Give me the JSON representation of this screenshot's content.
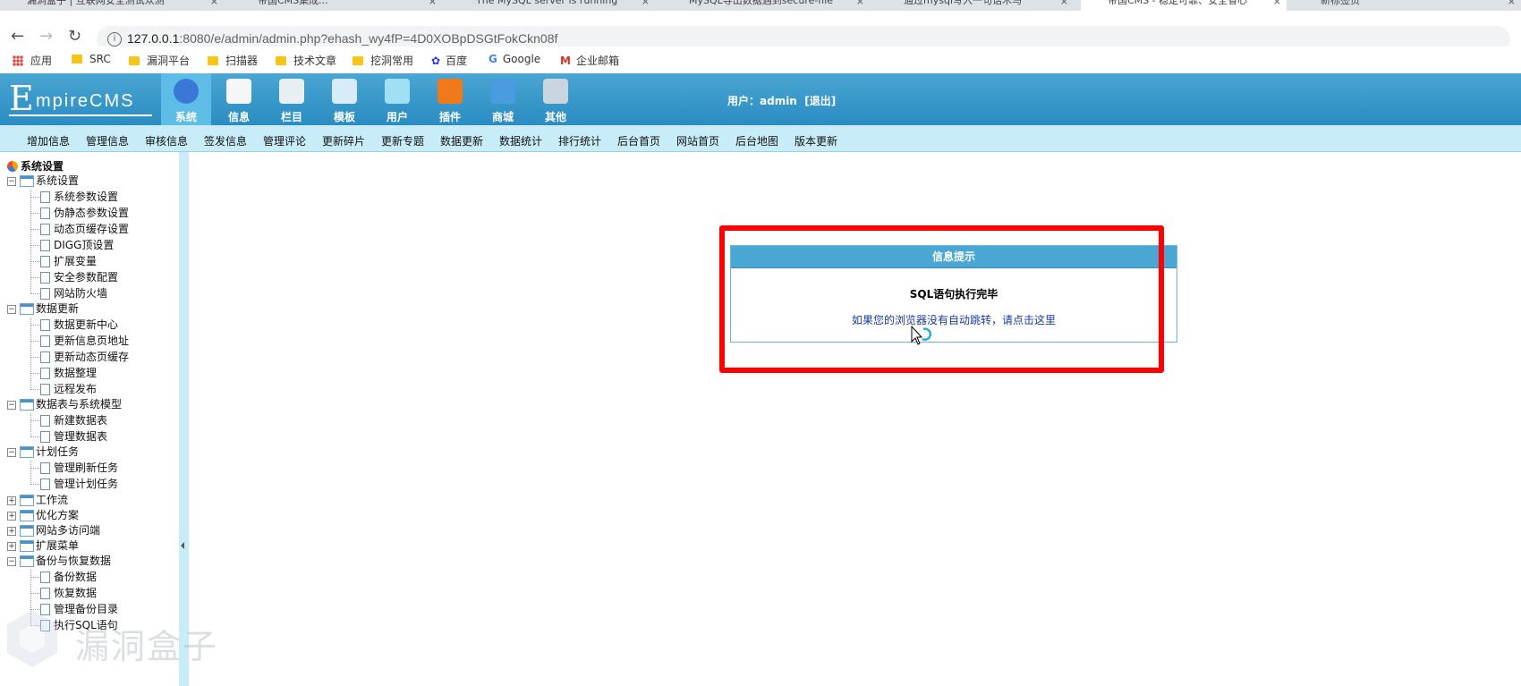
{
  "browser": {
    "tabs": [
      {
        "label": "漏洞盒子 | 互联网安全测试众测"
      },
      {
        "label": "帝国CMS集成..."
      },
      {
        "label": "The MySQL server is running"
      },
      {
        "label": "MySQL导出数据遇到secure-file"
      },
      {
        "label": "通过mysql写入一句话木马"
      },
      {
        "label": "帝国CMS - 稳定可靠、安全省心"
      },
      {
        "label": "新标签页"
      }
    ],
    "url_host": "127.0.0.1",
    "url_rest": ":8080/e/admin/admin.php?ehash_wy4fP=4D0XOBpDSGtFokCkn08f",
    "bookmarks": [
      "应用",
      "SRC",
      "漏洞平台",
      "扫描器",
      "技术文章",
      "挖洞常用",
      "百度",
      "Google",
      "企业邮箱"
    ]
  },
  "header": {
    "logo_big": "E",
    "logo_rest": "mpireCMS",
    "modules": [
      {
        "label": "系统",
        "icon": "globe-icon",
        "color": "#3a78d8"
      },
      {
        "label": "信息",
        "icon": "document-edit-icon",
        "color": "#f6f6f6"
      },
      {
        "label": "栏目",
        "icon": "folder-icon",
        "color": "#e9eef2"
      },
      {
        "label": "模板",
        "icon": "window-template-icon",
        "color": "#d8ecf8"
      },
      {
        "label": "用户",
        "icon": "user-icon",
        "color": "#9fe0f5"
      },
      {
        "label": "插件",
        "icon": "tools-icon",
        "color": "#f07a1a"
      },
      {
        "label": "商城",
        "icon": "credit-card-icon",
        "color": "#4a9ce0"
      },
      {
        "label": "其他",
        "icon": "gear-icon",
        "color": "#c9d6df"
      }
    ],
    "user_label": "用户：admin",
    "logout_label": "[退出]"
  },
  "subnav": [
    "增加信息",
    "管理信息",
    "审核信息",
    "签发信息",
    "管理评论",
    "更新碎片",
    "更新专题",
    "数据更新",
    "数据统计",
    "排行统计",
    "后台首页",
    "网站首页",
    "后台地图",
    "版本更新"
  ],
  "sidebar": {
    "root": "系统设置",
    "groups": [
      {
        "label": "系统设置",
        "open": true,
        "items": [
          "系统参数设置",
          "伪静态参数设置",
          "动态页缓存设置",
          "DIGG顶设置",
          "扩展变量",
          "安全参数配置",
          "网站防火墙"
        ]
      },
      {
        "label": "数据更新",
        "open": true,
        "items": [
          "数据更新中心",
          "更新信息页地址",
          "更新动态页缓存",
          "数据整理",
          "远程发布"
        ]
      },
      {
        "label": "数据表与系统模型",
        "open": true,
        "items": [
          "新建数据表",
          "管理数据表"
        ]
      },
      {
        "label": "计划任务",
        "open": true,
        "items": [
          "管理刷新任务",
          "管理计划任务"
        ]
      },
      {
        "label": "工作流",
        "open": false,
        "items": []
      },
      {
        "label": "优化方案",
        "open": false,
        "items": []
      },
      {
        "label": "网站多访问端",
        "open": false,
        "items": []
      },
      {
        "label": "扩展菜单",
        "open": false,
        "items": []
      },
      {
        "label": "备份与恢复数据",
        "open": true,
        "items": [
          "备份数据",
          "恢复数据",
          "管理备份目录",
          "执行SQL语句"
        ]
      }
    ]
  },
  "message": {
    "header": "信息提示",
    "title": "SQL语句执行完毕",
    "link": "如果您的浏览器没有自动跳转，请点击这里"
  },
  "watermark": "漏洞盒子"
}
